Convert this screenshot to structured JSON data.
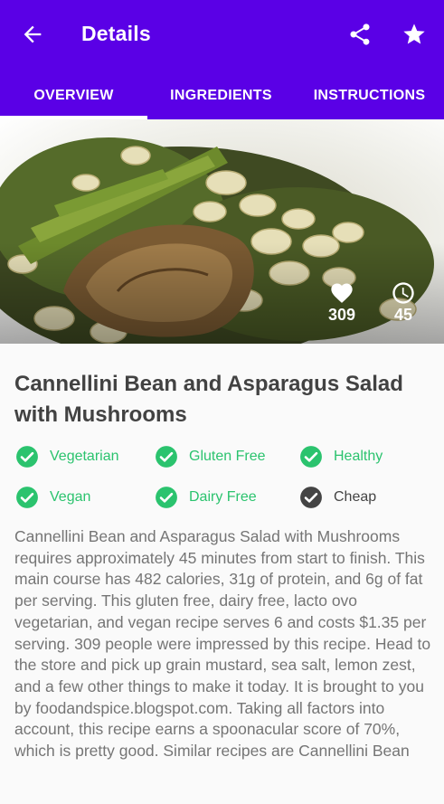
{
  "app_bar": {
    "title": "Details",
    "back_icon": "arrow-back-icon",
    "share_icon": "share-icon",
    "favorite_icon": "star-icon",
    "background_color": "#5a00e6"
  },
  "tabs": [
    {
      "label": "OVERVIEW",
      "selected": true
    },
    {
      "label": "INGREDIENTS",
      "selected": false
    },
    {
      "label": "INSTRUCTIONS",
      "selected": false
    }
  ],
  "hero": {
    "likes": "309",
    "likes_icon": "heart-icon",
    "minutes": "45",
    "minutes_icon": "clock-icon"
  },
  "recipe": {
    "title": "Cannellini Bean and Asparagus Salad with Mushrooms",
    "tags": [
      {
        "label": "Vegetarian",
        "active": true
      },
      {
        "label": "Gluten Free",
        "active": true
      },
      {
        "label": "Healthy",
        "active": true
      },
      {
        "label": "Vegan",
        "active": true
      },
      {
        "label": "Dairy Free",
        "active": true
      },
      {
        "label": "Cheap",
        "active": false
      }
    ],
    "summary": "Cannellini Bean and Asparagus Salad with Mushrooms requires approximately 45 minutes from start to finish. This main course has 482 calories, 31g of protein, and 6g of fat per serving. This gluten free, dairy free, lacto ovo vegetarian, and vegan recipe serves 6 and costs $1.35 per serving. 309 people were impressed by this recipe. Head to the store and pick up grain mustard, sea salt, lemon zest, and a few other things to make it today. It is brought to you by foodandspice.blogspot.com. Taking all factors into account, this recipe earns a spoonacular score of 70%, which is pretty good. Similar recipes are Cannellini Bean"
  },
  "colors": {
    "active_tag": "#2bc36e",
    "inactive_tag": "#444444",
    "title_text": "#424242",
    "body_text": "#757575"
  }
}
